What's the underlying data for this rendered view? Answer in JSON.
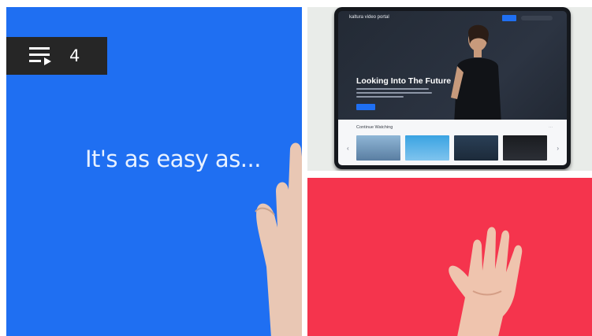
{
  "playlist_badge": {
    "count": "4",
    "icon": "playlist-play-icon"
  },
  "tile_blue": {
    "headline": "It's as easy as...",
    "background": "#1f6ff2"
  },
  "tile_laptop": {
    "brand": "kaltura video portal",
    "hero_title": "Looking Into The Future",
    "row_label": "Continue Watching"
  },
  "tile_red": {
    "background": "#f5344d"
  },
  "colors": {
    "accent_blue": "#1f6ff2",
    "accent_red": "#f5344d",
    "badge_bg": "#262626"
  }
}
